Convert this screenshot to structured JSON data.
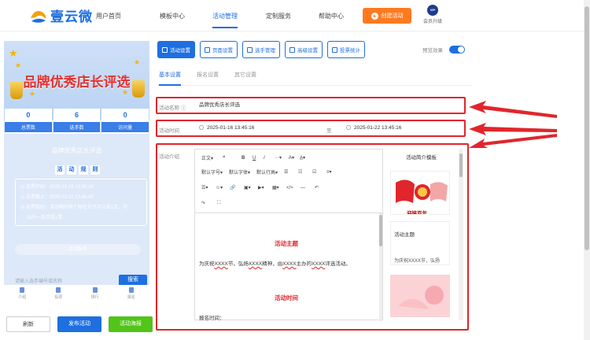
{
  "nav": {
    "logo_text": "壹云微",
    "items": [
      "用户首页",
      "模板中心",
      "活动管理",
      "定制服务",
      "帮助中心"
    ],
    "create_button": "创建活动",
    "vip_badge": "VIP",
    "vip_label": "会员升级"
  },
  "preview": {
    "banner_title": "品牌优秀店长评选",
    "stats": [
      {
        "value": "0",
        "label": "总票数"
      },
      {
        "value": "6",
        "label": "选手数"
      },
      {
        "value": "0",
        "label": "访问量"
      }
    ],
    "activity_title": "品牌优秀店长评选",
    "rules_chars": [
      "活",
      "动",
      "规",
      "则"
    ],
    "rule_lines": [
      "投票开始：2025-01-16 13:45:16",
      "投票截止：2025-01-22 13:45:16",
      "投票规则：活动期间每个微信号只可以投1次，可",
      "以同一选手投1票"
    ],
    "join_button": "活动报名",
    "search_placeholder": "请输入选手编号或名称",
    "search_button": "搜索",
    "bottom_tabs": [
      "介绍",
      "投票",
      "排行",
      "报名"
    ],
    "colors": {
      "accent": "#1e6fe0",
      "title": "#e3312f"
    }
  },
  "actions": {
    "refresh": "刷新",
    "publish": "发布活动",
    "poster": "活动海报"
  },
  "tabs": [
    {
      "label": "活动设置",
      "active": true
    },
    {
      "label": "页面设置",
      "active": false
    },
    {
      "label": "选手管理",
      "active": false
    },
    {
      "label": "高级设置",
      "active": false
    },
    {
      "label": "投票统计",
      "active": false
    }
  ],
  "preview_toggle": {
    "label": "预览效果",
    "on": true
  },
  "subtabs": [
    "基本设置",
    "报名设置",
    "其它设置"
  ],
  "form": {
    "name_label": "活动名称",
    "name_value": "品牌优秀店长评选",
    "time_label": "活动时间",
    "time_start": "2025-01-16 13:45:16",
    "time_sep": "至",
    "time_end": "2025-01-22 13:45:16",
    "intro_label": "活动介绍"
  },
  "editor": {
    "toolbar_row1": [
      "正文▾",
      "❝",
      "B",
      "U",
      "I",
      "···▾",
      "A▾",
      "A̲▾"
    ],
    "toolbar_row2": [
      "默认字号▾",
      "默认字体▾",
      "默认行高▾",
      "☰",
      "☷",
      "☑",
      "≡▾"
    ],
    "toolbar_row3": [
      "☰▾",
      "☺▾",
      "🔗",
      "▣▾",
      "▶▾",
      "▦▾",
      "</>",
      "—",
      "↶"
    ],
    "toolbar_row4": [
      "↷",
      "⛶"
    ],
    "section1": "活动主题",
    "para1_prefix": "为庆祝",
    "para1_x1": "XXXX",
    "para1_mid1": "节，弘扬",
    "para1_x2": "XXXX",
    "para1_mid2": "精神，由",
    "para1_x3": "XXXX",
    "para1_mid3": "主办的",
    "para1_x4": "XXXX",
    "para1_suffix": "评选活动。",
    "section2": "活动时间",
    "line_signup": "报名时间："
  },
  "templates": {
    "title": "活动简介模板",
    "card1_text": "迎接百年",
    "card2_title": "活动主题",
    "card2_body": "为庆祝XXXX节，弘扬"
  }
}
